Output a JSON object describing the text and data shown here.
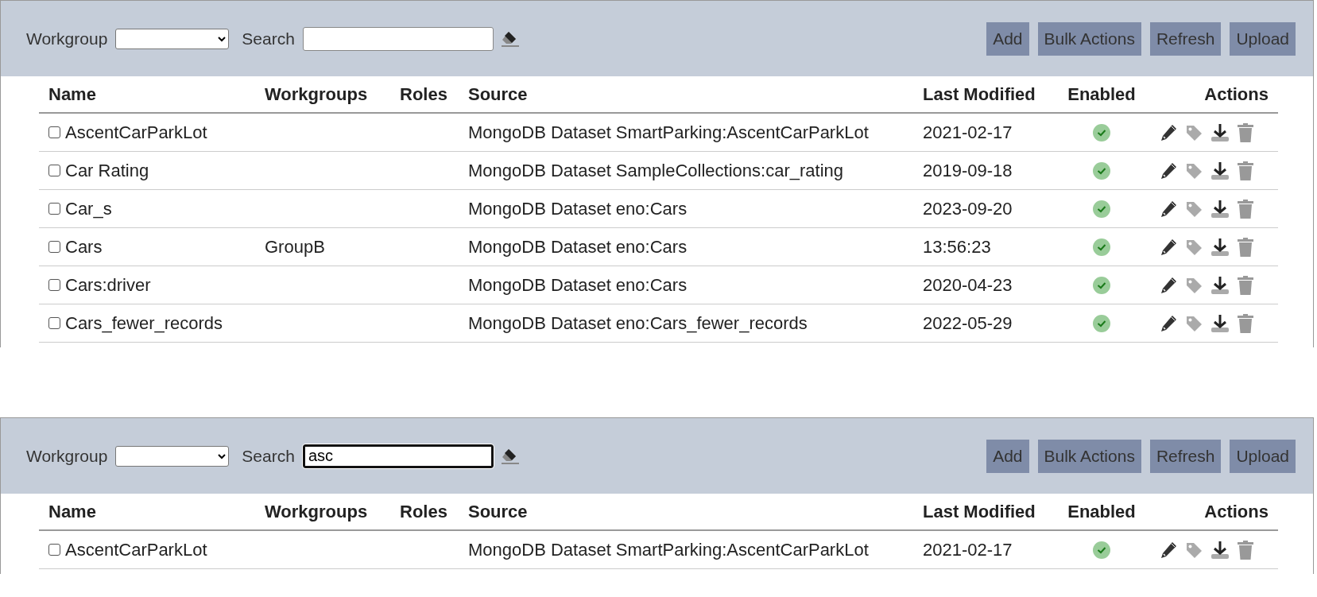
{
  "panels": [
    {
      "toolbar": {
        "workgroup_label": "Workgroup",
        "search_label": "Search",
        "search": {
          "focused": false
        },
        "buttons": [
          "Add",
          "Bulk Actions",
          "Refresh",
          "Upload"
        ]
      },
      "table": {
        "columns": [
          "Name",
          "Workgroups",
          "Roles",
          "Source",
          "Last Modified",
          "Enabled",
          "Actions"
        ],
        "rows": [
          {
            "checked": false,
            "name": "AscentCarParkLot",
            "source": "MongoDB Dataset SmartParking:AscentCarParkLot",
            "last_modified": "2021-02-17",
            "enabled": true
          },
          {
            "checked": false,
            "name": "Car Rating",
            "source": "MongoDB Dataset SampleCollections:car_rating",
            "last_modified": "2019-09-18",
            "enabled": true
          },
          {
            "checked": false,
            "name": "Car_s",
            "source": "MongoDB Dataset eno:Cars",
            "last_modified": "2023-09-20",
            "enabled": true
          },
          {
            "checked": false,
            "name": "Cars",
            "workgroups": "GroupB",
            "source": "MongoDB Dataset eno:Cars",
            "last_modified": "13:56:23",
            "enabled": true
          },
          {
            "checked": false,
            "name": "Cars:driver",
            "source": "MongoDB Dataset eno:Cars",
            "last_modified": "2020-04-23",
            "enabled": true
          },
          {
            "checked": false,
            "name": "Cars_fewer_records",
            "source": "MongoDB Dataset eno:Cars_fewer_records",
            "last_modified": "2022-05-29",
            "enabled": true
          }
        ]
      }
    },
    {
      "toolbar": {
        "workgroup_label": "Workgroup",
        "search_label": "Search",
        "search": {
          "value": "asc",
          "focused": true
        },
        "buttons": [
          "Add",
          "Bulk Actions",
          "Refresh",
          "Upload"
        ]
      },
      "table": {
        "columns": [
          "Name",
          "Workgroups",
          "Roles",
          "Source",
          "Last Modified",
          "Enabled",
          "Actions"
        ],
        "rows": [
          {
            "checked": false,
            "name": "AscentCarParkLot",
            "source": "MongoDB Dataset SmartParking:AscentCarParkLot",
            "last_modified": "2021-02-17",
            "enabled": true
          }
        ]
      }
    }
  ]
}
